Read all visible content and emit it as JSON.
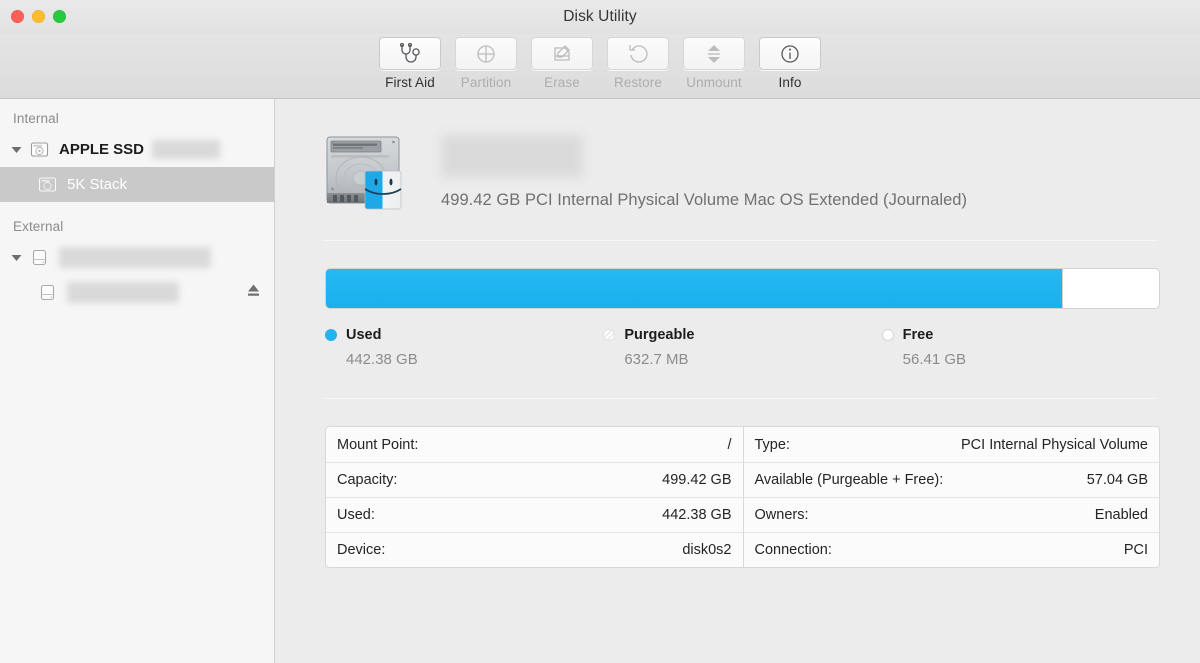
{
  "window": {
    "title": "Disk Utility"
  },
  "traffic_lights": [
    {
      "name": "close",
      "color": "#ff5f57"
    },
    {
      "name": "minimize",
      "color": "#ffbd2e"
    },
    {
      "name": "zoom",
      "color": "#28c940"
    }
  ],
  "toolbar": {
    "items": [
      {
        "label": "First Aid",
        "icon": "stethoscope-icon",
        "enabled": true
      },
      {
        "label": "Partition",
        "icon": "pie-chart-icon",
        "enabled": false
      },
      {
        "label": "Erase",
        "icon": "erase-pencil-icon",
        "enabled": false
      },
      {
        "label": "Restore",
        "icon": "undo-arrow-icon",
        "enabled": false
      },
      {
        "label": "Unmount",
        "icon": "eject-icon",
        "enabled": false
      },
      {
        "label": "Info",
        "icon": "info-circle-icon",
        "enabled": true
      }
    ]
  },
  "sidebar": {
    "groups": [
      {
        "title": "Internal",
        "rows": [
          {
            "label": "APPLE SSD",
            "blurred_suffix_width": 66,
            "icon": "internal-disk-icon",
            "level": 0,
            "selected": false,
            "disclosure": true,
            "eject": false
          },
          {
            "label": "5K Stack",
            "blurred_suffix_width": 0,
            "icon": "volume-icon",
            "level": 1,
            "selected": true,
            "disclosure": false,
            "eject": false
          }
        ]
      },
      {
        "title": "External",
        "rows": [
          {
            "label": "",
            "blurred_label_width": 150,
            "icon": "external-disk-icon",
            "level": 0,
            "selected": false,
            "disclosure": true,
            "eject": false
          },
          {
            "label": "",
            "blurred_label_width": 110,
            "icon": "external-disk-icon",
            "level": 1,
            "selected": false,
            "disclosure": false,
            "eject": true
          }
        ]
      }
    ]
  },
  "volume": {
    "icon": "hard-drive-finder-icon",
    "name_redacted": true,
    "subtitle": "499.42 GB PCI Internal Physical Volume Mac OS Extended (Journaled)"
  },
  "capacity": {
    "used_percent": 88.5,
    "bar_used_color": "#22b3f0",
    "bar_free_color": "#ffffff",
    "legend": [
      {
        "key": "used",
        "label": "Used",
        "value": "442.38 GB"
      },
      {
        "key": "purgeable",
        "label": "Purgeable",
        "value": "632.7 MB"
      },
      {
        "key": "free",
        "label": "Free",
        "value": "56.41 GB"
      }
    ]
  },
  "details": {
    "left": [
      {
        "key": "Mount Point:",
        "value": "/"
      },
      {
        "key": "Capacity:",
        "value": "499.42 GB"
      },
      {
        "key": "Used:",
        "value": "442.38 GB"
      },
      {
        "key": "Device:",
        "value": "disk0s2"
      }
    ],
    "right": [
      {
        "key": "Type:",
        "value": "PCI Internal Physical Volume"
      },
      {
        "key": "Available (Purgeable + Free):",
        "value": "57.04 GB"
      },
      {
        "key": "Owners:",
        "value": "Enabled"
      },
      {
        "key": "Connection:",
        "value": "PCI"
      }
    ]
  }
}
